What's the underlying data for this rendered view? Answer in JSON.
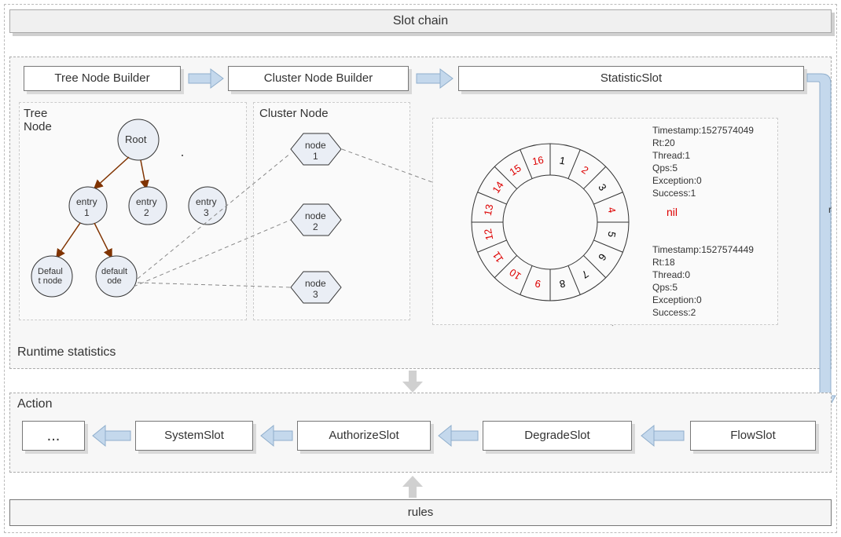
{
  "title": "Slot chain",
  "builders": {
    "tree": "Tree Node Builder",
    "cluster": "Cluster Node Builder",
    "statistic": "StatisticSlot"
  },
  "tree_node": {
    "label": "Tree\nNode",
    "root": "Root",
    "entry1": "entry\n1",
    "entry2": "entry\n2",
    "entry3": "entry\n3",
    "defaultnode": "Defaul\nt node",
    "defaultnode2": "default\node"
  },
  "cluster_node": {
    "label": "Cluster Node",
    "n1": "node\n1",
    "n2": "node\n2",
    "n3": "node\n3"
  },
  "wheel": {
    "segments": [
      "1",
      "2",
      "3",
      "4",
      "5",
      "6",
      "7",
      "8",
      "9",
      "10",
      "11",
      "12",
      "13",
      "14",
      "15",
      "16"
    ]
  },
  "stats1": {
    "timestamp": "Timestamp:1527574049",
    "rt": "Rt:20",
    "thread": "Thread:1",
    "qps": "Qps:5",
    "exception": "Exception:0",
    "success": "Success:1"
  },
  "nil_label": "nil",
  "stats2": {
    "timestamp": "Timestamp:1527574449",
    "rt": "Rt:18",
    "thread": "Thread:0",
    "qps": "Qps:5",
    "exception": "Exception:0",
    "success": "Success:2"
  },
  "runtime_label": "Runtime statistics",
  "action_label": "Action",
  "action_slots": {
    "more": "...",
    "system": "SystemSlot",
    "authorize": "AuthorizeSlot",
    "degrade": "DegradeSlot",
    "flow": "FlowSlot"
  },
  "rules_label": "rules"
}
